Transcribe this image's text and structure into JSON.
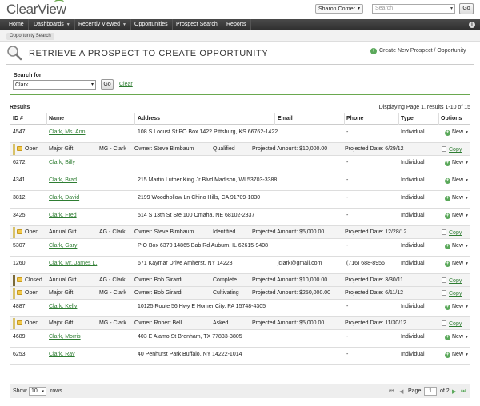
{
  "app": {
    "logo": "ClearView"
  },
  "header": {
    "user": "Sharon Corner",
    "search_placeholder": "Search",
    "go": "Go"
  },
  "nav": {
    "items": [
      {
        "label": "Home",
        "dropdown": false
      },
      {
        "label": "Dashboards",
        "dropdown": true
      },
      {
        "label": "Recently Viewed",
        "dropdown": true
      },
      {
        "label": "Opportunities",
        "dropdown": false
      },
      {
        "label": "Prospect Search",
        "dropdown": false
      },
      {
        "label": "Reports",
        "dropdown": false
      }
    ],
    "info_glyph": "i"
  },
  "breadcrumb": {
    "current": "Opportunity Search"
  },
  "page": {
    "title": "RETRIEVE A PROSPECT TO CREATE OPPORTUNITY",
    "create_link": "Create New Prospect / Opportunity"
  },
  "search": {
    "label": "Search for",
    "value": "Clark",
    "go": "Go",
    "clear": "Clear"
  },
  "results": {
    "label": "Results",
    "displaying": "Displaying Page 1, results 1-10 of 15",
    "columns": [
      "ID #",
      "Name",
      "Address",
      "Email",
      "Phone",
      "Type",
      "Options"
    ],
    "new_label": "New",
    "copy_label": "Copy",
    "rows": [
      {
        "id": "4547",
        "name": "Clark, Ms. Ann",
        "address": "108 S Locust St PO Box 1422 Pittsburg, KS 66762-1422",
        "email": "",
        "phone": "-",
        "type": "Individual",
        "opps": [
          {
            "status": "Open",
            "kind": "Major Gift",
            "code": "MG - Clark",
            "owner": "Owner: Steve Birnbaum",
            "stage": "Qualified",
            "amount": "Projected Amount: $10,000.00",
            "date": "Projected Date: 6/29/12"
          }
        ]
      },
      {
        "id": "6272",
        "name": "Clark, Billy",
        "address": "",
        "email": "",
        "phone": "-",
        "type": "Individual",
        "opps": []
      },
      {
        "id": "4341",
        "name": "Clark, Brad",
        "address": "215 Martin Luther King Jr Blvd Madison, WI 53703-3388",
        "email": "",
        "phone": "-",
        "type": "Individual",
        "opps": []
      },
      {
        "id": "3812",
        "name": "Clark, David",
        "address": "2199 Woodhollow Ln Chino Hills, CA 91709-1030",
        "email": "",
        "phone": "-",
        "type": "Individual",
        "opps": []
      },
      {
        "id": "3425",
        "name": "Clark, Fred",
        "address": "514 S 13th St Ste 100 Omaha, NE 68102-2837",
        "email": "",
        "phone": "-",
        "type": "Individual",
        "opps": [
          {
            "status": "Open",
            "kind": "Annual Gift",
            "code": "AG - Clark",
            "owner": "Owner: Steve Birnbaum",
            "stage": "Identified",
            "amount": "Projected Amount: $5,000.00",
            "date": "Projected Date: 12/28/12"
          }
        ]
      },
      {
        "id": "5307",
        "name": "Clark, Gary",
        "address": "P O Box 6370 14865 Bab Rd Auburn, IL 62615-9408",
        "email": "",
        "phone": "-",
        "type": "Individual",
        "opps": []
      },
      {
        "id": "1260",
        "name": "Clark, Mr. James L.",
        "address": "671 Kaymar Drive Amherst, NY 14228",
        "email": "jclark@gmail.com",
        "phone": "(716) 688-8956",
        "type": "Individual",
        "opps": [
          {
            "status": "Closed",
            "kind": "Annual Gift",
            "code": "AG - Clark",
            "owner": "Owner: Bob Girardi",
            "stage": "Complete",
            "amount": "Projected Amount: $10,000.00",
            "date": "Projected Date: 3/30/11"
          },
          {
            "status": "Open",
            "kind": "Major Gift",
            "code": "MG - Clark",
            "owner": "Owner: Bob Girardi",
            "stage": "Cultivating",
            "amount": "Projected Amount: $250,000.00",
            "date": "Projected Date: 6/11/12"
          }
        ]
      },
      {
        "id": "4887",
        "name": "Clark, Kelly",
        "address": "10125 Route 56 Hwy E Homer City, PA 15748-4305",
        "email": "",
        "phone": "-",
        "type": "Individual",
        "opps": [
          {
            "status": "Open",
            "kind": "Major Gift",
            "code": "MG - Clark",
            "owner": "Owner: Robert Bell",
            "stage": "Asked",
            "amount": "Projected Amount: $5,000.00",
            "date": "Projected Date: 11/30/12"
          }
        ]
      },
      {
        "id": "4689",
        "name": "Clark, Morris",
        "address": "403 E Alamo St Brenham, TX 77833-3805",
        "email": "",
        "phone": "-",
        "type": "Individual",
        "opps": []
      },
      {
        "id": "6253",
        "name": "Clark, Ray",
        "address": "40 Penhurst Park Buffalo, NY 14222-1014",
        "email": "",
        "phone": "-",
        "type": "Individual",
        "opps": []
      }
    ]
  },
  "footer": {
    "show_label": "Show",
    "show_value": "10",
    "rows_label": "rows",
    "page_label": "Page",
    "page_value": "1",
    "of_label": "of 2"
  },
  "colors": {
    "accent": "#5aa85a",
    "nav_bg": "#3a3a3a",
    "link": "#2e7d32"
  }
}
